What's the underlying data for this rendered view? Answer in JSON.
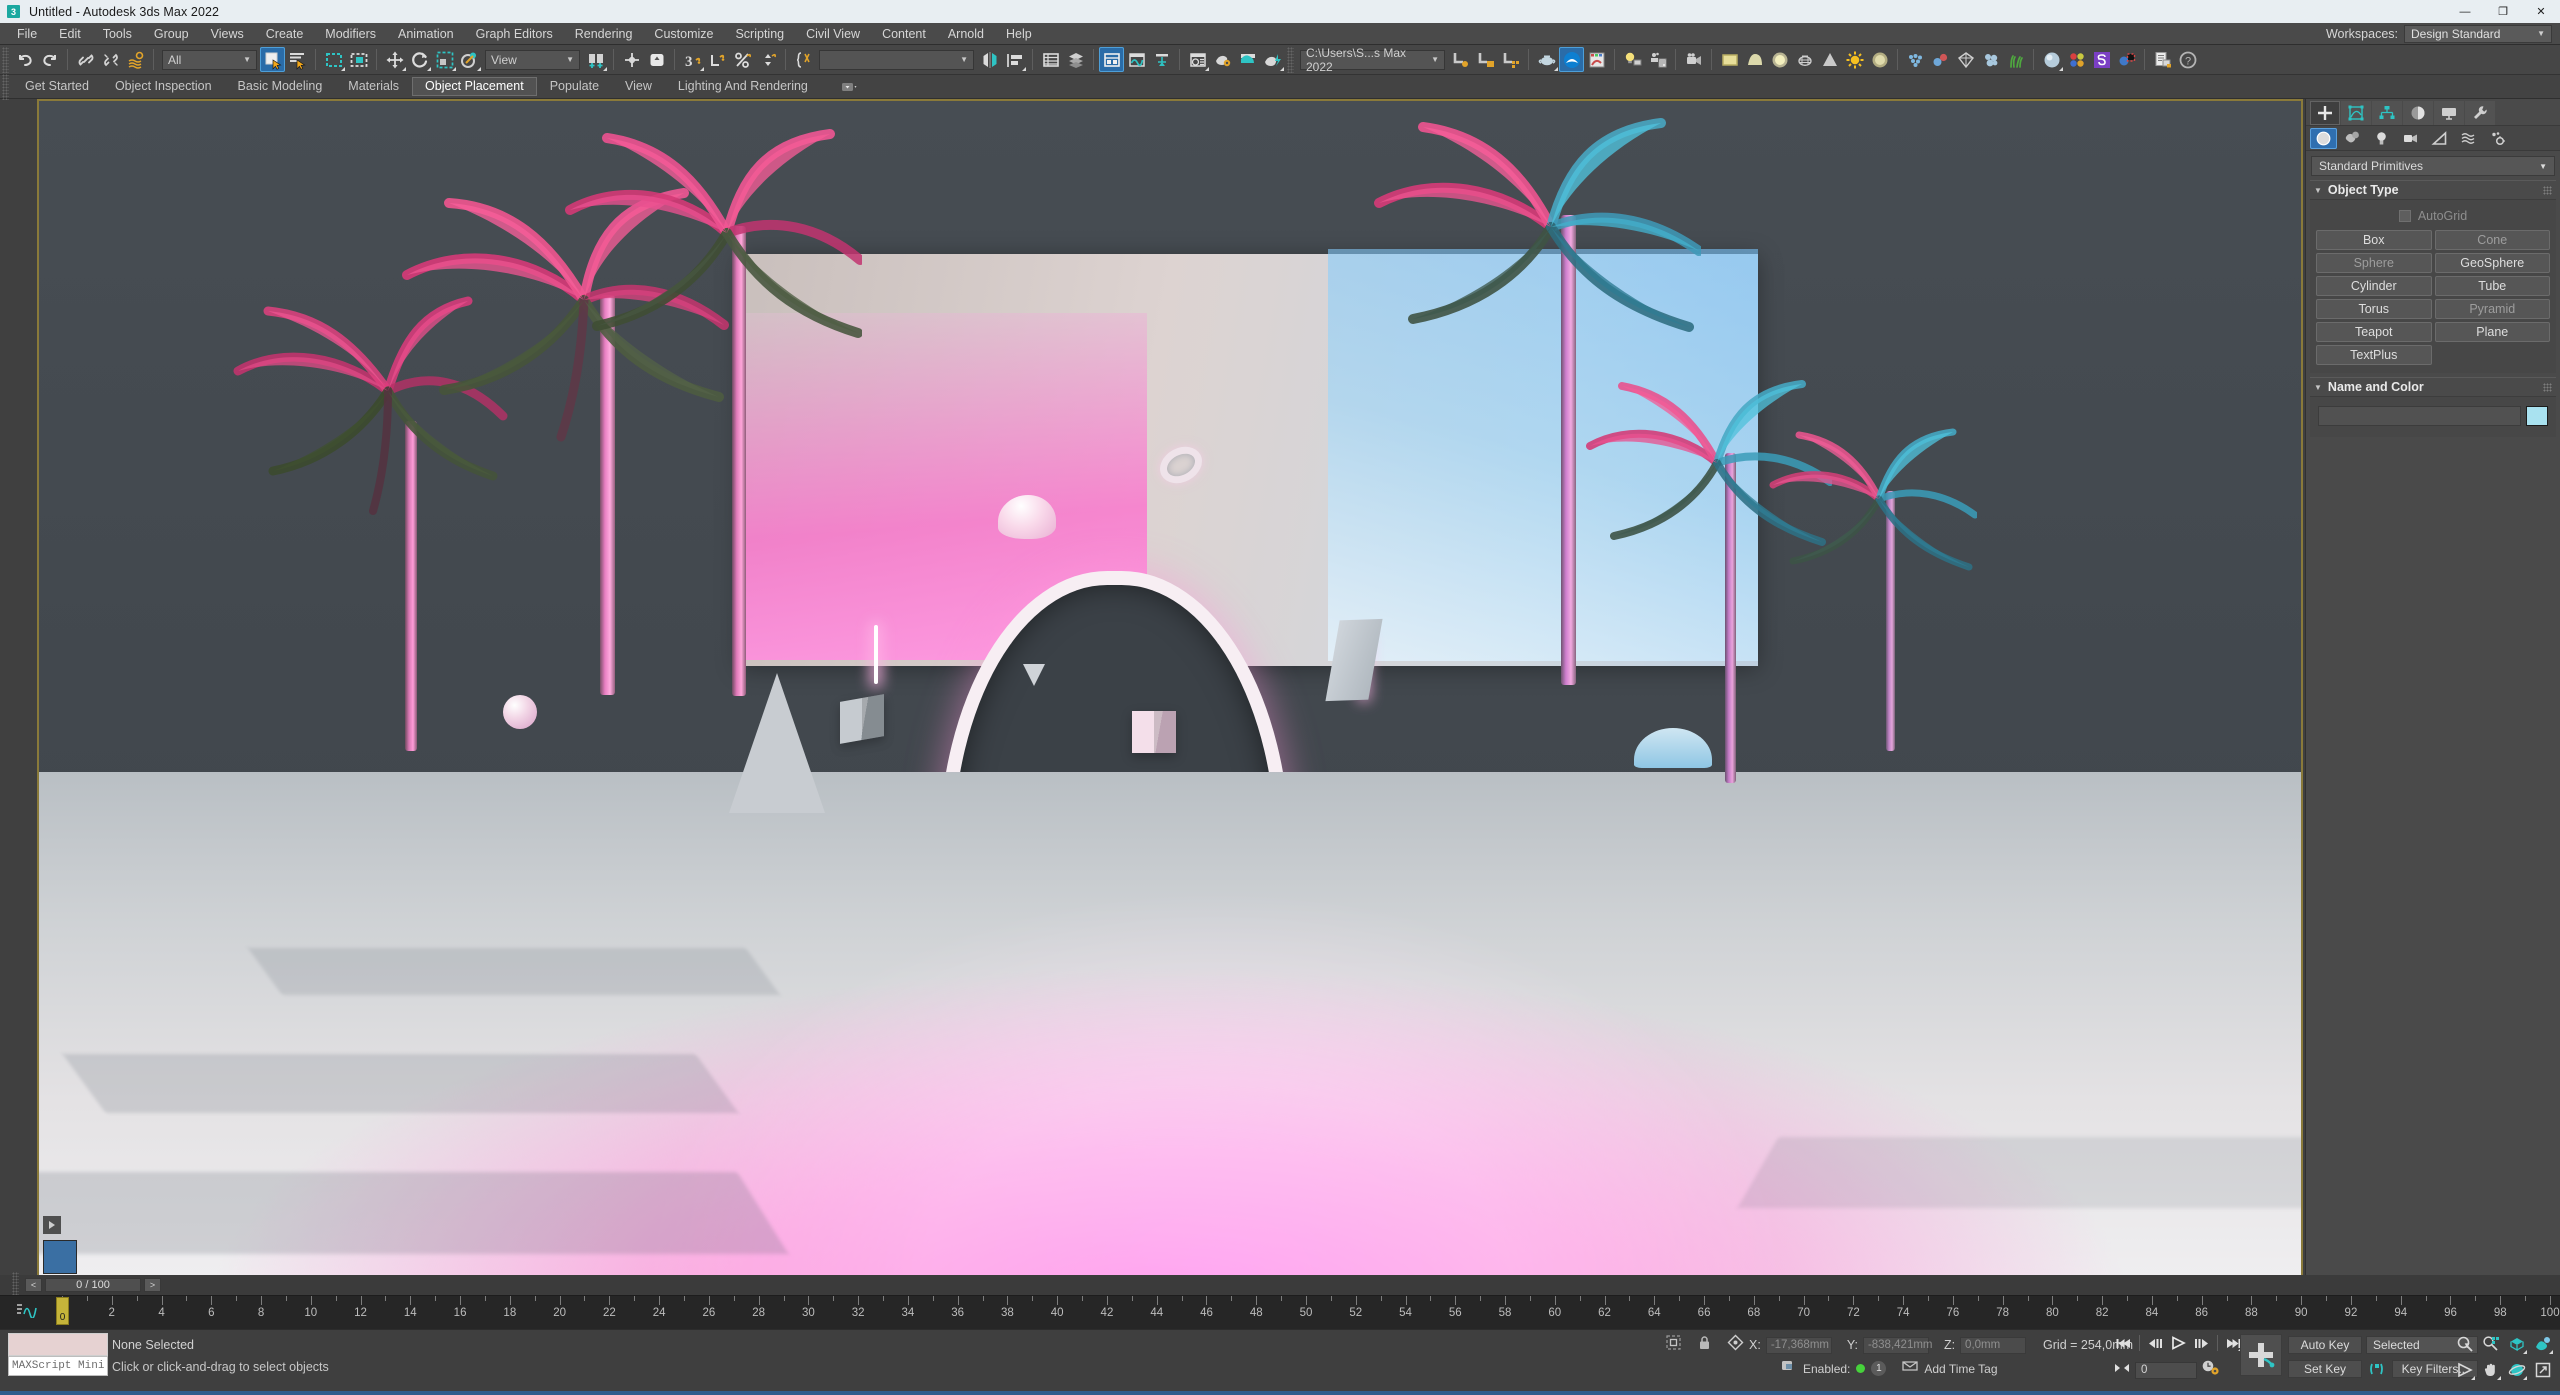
{
  "titlebar": {
    "logo_text": "3",
    "title": "Untitled - Autodesk 3ds Max 2022",
    "minimize": "—",
    "maximize": "❐",
    "close": "✕"
  },
  "menubar": {
    "items": [
      {
        "label": "File"
      },
      {
        "label": "Edit"
      },
      {
        "label": "Tools"
      },
      {
        "label": "Group"
      },
      {
        "label": "Views"
      },
      {
        "label": "Create"
      },
      {
        "label": "Modifiers"
      },
      {
        "label": "Animation"
      },
      {
        "label": "Graph Editors"
      },
      {
        "label": "Rendering"
      },
      {
        "label": "Customize"
      },
      {
        "label": "Scripting"
      },
      {
        "label": "Civil View"
      },
      {
        "label": "Content"
      },
      {
        "label": "Arnold"
      },
      {
        "label": "Help"
      }
    ],
    "workspaces_label": "Workspaces:",
    "workspace_value": "Design Standard"
  },
  "toolbar": {
    "selection_filter": "All",
    "reference_coord": "View",
    "named_selection_set": "",
    "project_path": "C:\\Users\\S...s Max 2022",
    "icons": [
      {
        "name": "undo-icon",
        "title": "Undo"
      },
      {
        "name": "redo-icon",
        "title": "Redo"
      },
      {
        "name": "select-link-icon",
        "title": "Select and Link"
      },
      {
        "name": "unlink-selection-icon",
        "title": "Unlink Selection"
      },
      {
        "name": "bind-space-warp-icon",
        "title": "Bind to Space Warp"
      },
      {
        "name": "select-object-icon",
        "title": "Select Object"
      },
      {
        "name": "select-by-name-icon",
        "title": "Select by Name"
      },
      {
        "name": "rectangular-selection-region-icon",
        "title": "Rectangular Selection Region"
      },
      {
        "name": "window-crossing-icon",
        "title": "Window/Crossing"
      },
      {
        "name": "select-and-move-icon",
        "title": "Select and Move"
      },
      {
        "name": "select-and-rotate-icon",
        "title": "Select and Rotate"
      },
      {
        "name": "select-and-scale-icon",
        "title": "Select and Uniform Scale"
      },
      {
        "name": "select-and-place-icon",
        "title": "Select and Place"
      },
      {
        "name": "use-center-flyout-icon",
        "title": "Use Pivot Point Center"
      },
      {
        "name": "select-and-manipulate-icon",
        "title": "Select and Manipulate"
      },
      {
        "name": "snaps-toggle-icon",
        "title": "Snaps Toggle"
      },
      {
        "name": "angle-snap-toggle-icon",
        "title": "Angle Snap Toggle"
      },
      {
        "name": "percent-snap-toggle-icon",
        "title": "Percent Snap Toggle"
      },
      {
        "name": "spinner-snap-toggle-icon",
        "title": "Spinner Snap Toggle"
      },
      {
        "name": "edit-named-selection-sets-icon",
        "title": "Edit Named Selection Sets"
      },
      {
        "name": "mirror-icon",
        "title": "Mirror"
      },
      {
        "name": "align-icon",
        "title": "Align"
      },
      {
        "name": "layer-explorer-icon",
        "title": "Toggle Scene Explorer"
      },
      {
        "name": "layer-manager-icon",
        "title": "Manage Layers"
      },
      {
        "name": "toggle-ribbon-icon",
        "title": "Toggle Ribbon"
      },
      {
        "name": "curve-editor-icon",
        "title": "Curve Editor"
      },
      {
        "name": "schematic-view-icon",
        "title": "Schematic View"
      },
      {
        "name": "material-editor-icon",
        "title": "Material Editor"
      },
      {
        "name": "render-setup-icon",
        "title": "Render Setup"
      },
      {
        "name": "rendered-frame-window-icon",
        "title": "Rendered Frame Window"
      },
      {
        "name": "render-production-icon",
        "title": "Render Production"
      },
      {
        "name": "open-explorer-icon",
        "title": "Open Explorer"
      },
      {
        "name": "project-folder-icon",
        "title": "Project Folder"
      },
      {
        "name": "save-state-icon",
        "title": "Save State"
      },
      {
        "name": "asset-tracking-icon",
        "title": "Asset Tracking"
      },
      {
        "name": "teapot-icon",
        "title": "Create Teapot"
      },
      {
        "name": "arnold-icon",
        "title": "Arnold Renderer"
      },
      {
        "name": "slate-material-icon",
        "title": "Slate Material Editor"
      },
      {
        "name": "light-icon",
        "title": "Light"
      },
      {
        "name": "camera-settings-icon",
        "title": "Camera Settings"
      },
      {
        "name": "camera-icon",
        "title": "Physical Camera"
      },
      {
        "name": "quad-menu-icon",
        "title": "Quad"
      },
      {
        "name": "dome-light-icon",
        "title": "Dome Light"
      },
      {
        "name": "area-light-icon",
        "title": "Area Light"
      },
      {
        "name": "mesh-light-icon",
        "title": "Mesh Light"
      },
      {
        "name": "volume-icon",
        "title": "Volume"
      },
      {
        "name": "sun-icon",
        "title": "Sun"
      },
      {
        "name": "sky-icon",
        "title": "Sky"
      },
      {
        "name": "particle-icon",
        "title": "Particles"
      },
      {
        "name": "atmosphere-icon",
        "title": "Atmosphere"
      },
      {
        "name": "proxy-icon",
        "title": "Proxy"
      },
      {
        "name": "noise-icon",
        "title": "Noise"
      },
      {
        "name": "grass-icon",
        "title": "Scatter"
      },
      {
        "name": "material-sphere-icon",
        "title": "Material"
      },
      {
        "name": "color-swatches-icon",
        "title": "Color"
      },
      {
        "name": "substance-icon",
        "title": "Substance"
      },
      {
        "name": "state-sets-icon",
        "title": "State Sets"
      },
      {
        "name": "scene-converter-icon",
        "title": "Scene Converter"
      },
      {
        "name": "help-icon",
        "title": "Help"
      }
    ]
  },
  "ribbon": {
    "tabs": [
      {
        "label": "Get Started",
        "selected": false
      },
      {
        "label": "Object Inspection",
        "selected": false
      },
      {
        "label": "Basic Modeling",
        "selected": false
      },
      {
        "label": "Materials",
        "selected": false
      },
      {
        "label": "Object Placement",
        "selected": true
      },
      {
        "label": "Populate",
        "selected": false
      },
      {
        "label": "View",
        "selected": false
      },
      {
        "label": "Lighting And Rendering",
        "selected": false
      }
    ],
    "overflow_icon": "ribbon-options-icon"
  },
  "command_panel": {
    "tabs": [
      {
        "name": "create-tab",
        "glyph": "+",
        "selected": true
      },
      {
        "name": "modify-tab",
        "glyph": "modify",
        "selected": false
      },
      {
        "name": "hierarchy-tab",
        "glyph": "hierarchy",
        "selected": false
      },
      {
        "name": "motion-tab",
        "glyph": "motion",
        "selected": false
      },
      {
        "name": "display-tab",
        "glyph": "display",
        "selected": false
      },
      {
        "name": "utilities-tab",
        "glyph": "wrench",
        "selected": false
      }
    ],
    "subtabs": [
      {
        "name": "geometry-subtab",
        "selected": true
      },
      {
        "name": "shapes-subtab",
        "selected": false
      },
      {
        "name": "lights-subtab",
        "selected": false
      },
      {
        "name": "cameras-subtab",
        "selected": false
      },
      {
        "name": "helpers-subtab",
        "selected": false
      },
      {
        "name": "space-warps-subtab",
        "selected": false
      },
      {
        "name": "systems-subtab",
        "selected": false
      }
    ],
    "category_dropdown": "Standard Primitives",
    "object_type": {
      "title": "Object Type",
      "autogrid_label": "AutoGrid",
      "autogrid_checked": false,
      "buttons": [
        "Box",
        "Cone",
        "Sphere",
        "GeoSphere",
        "Cylinder",
        "Tube",
        "Torus",
        "Pyramid",
        "Teapot",
        "Plane",
        "TextPlus"
      ]
    },
    "name_and_color": {
      "title": "Name and Color",
      "name_value": "",
      "color_hex": "#a9e2f0"
    }
  },
  "viewport": {
    "label": "",
    "active_border_color": "#8a7a3a",
    "scene_description": "Neon-lit vaporwave 3D scene: pale arch wall, palm trees, primitive shapes on a pink-lit floor"
  },
  "timeline": {
    "prev_frame": "<",
    "next_frame": ">",
    "frame_readout": "0 / 100",
    "current_frame": 0,
    "range_start": 0,
    "range_end": 100,
    "tick_labels": [
      2,
      4,
      6,
      8,
      10,
      12,
      14,
      16,
      18,
      20,
      22,
      24,
      26,
      28,
      30,
      32,
      34,
      36,
      38,
      40,
      42,
      44,
      46,
      48,
      50,
      52,
      54,
      56,
      58,
      60,
      62,
      64,
      66,
      68,
      70,
      72,
      74,
      76,
      78,
      80,
      82,
      84,
      86,
      88,
      90,
      92,
      94,
      96,
      98,
      100
    ],
    "playhead_label": "0"
  },
  "statusbar": {
    "maxscript_entry_placeholder": "MAXScript Mini Listener",
    "selection_status": "None Selected",
    "prompt": "Click or click-and-drag to select objects",
    "coords": {
      "x_label": "X:",
      "x_value": "-17,368mm",
      "y_label": "Y:",
      "y_value": "-838,421mm",
      "z_label": "Z:",
      "z_value": "0,0mm"
    },
    "grid_text": "Grid = 254,0mm",
    "enabled_label": "Enabled:",
    "enabled_count": "1",
    "add_time_tag": "Add Time Tag",
    "auto_key": "Auto Key",
    "set_key": "Set Key",
    "key_filters": "Key Filters...",
    "selected_dropdown": "Selected",
    "spinner_value": "0",
    "nav_icons_top": [
      {
        "name": "zoom-icon"
      },
      {
        "name": "zoom-all-icon"
      },
      {
        "name": "zoom-extents-icon"
      },
      {
        "name": "zoom-region-icon"
      }
    ],
    "nav_icons_bottom": [
      {
        "name": "field-of-view-icon"
      },
      {
        "name": "pan-view-icon"
      },
      {
        "name": "orbit-icon"
      },
      {
        "name": "maximize-viewport-icon"
      }
    ],
    "playback_icons": [
      {
        "name": "goto-start-icon"
      },
      {
        "name": "previous-frame-icon"
      },
      {
        "name": "play-animation-icon"
      },
      {
        "name": "next-frame-icon"
      },
      {
        "name": "goto-end-icon"
      }
    ]
  }
}
